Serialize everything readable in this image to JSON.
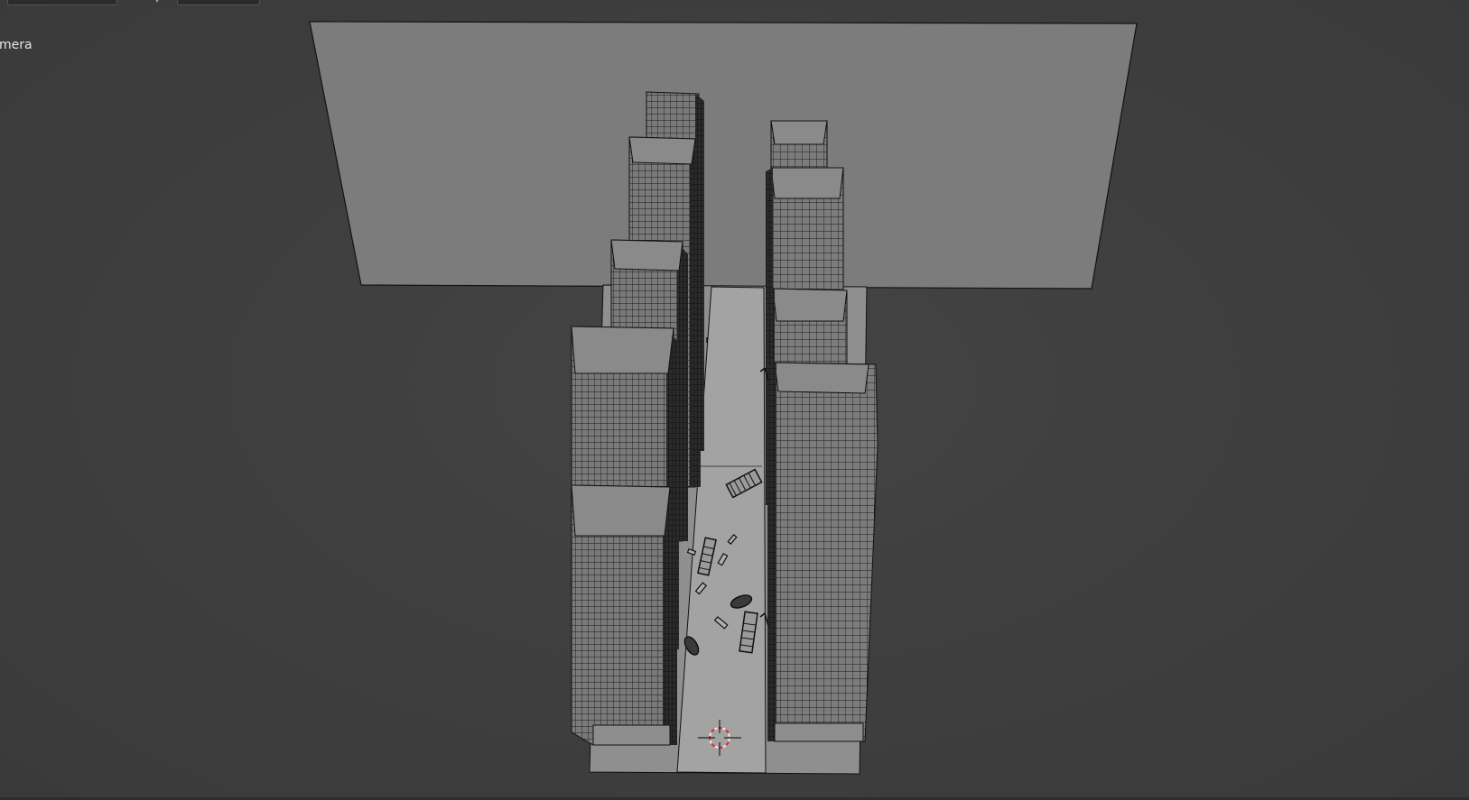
{
  "viewport": {
    "label": "mera",
    "background": "#3d3d3d",
    "plane_color": "#7c7c7c",
    "street_color": "#9c9c9c",
    "wire_color": "#111111"
  },
  "scene": {
    "objects": [
      "backdrop-plane",
      "ground-plane",
      "street",
      "building",
      "building",
      "building",
      "building",
      "building",
      "building",
      "building",
      "building",
      "bus",
      "bus",
      "bus",
      "car",
      "car",
      "debris",
      "streetlamp"
    ],
    "cursor": "3d-cursor-icon"
  }
}
